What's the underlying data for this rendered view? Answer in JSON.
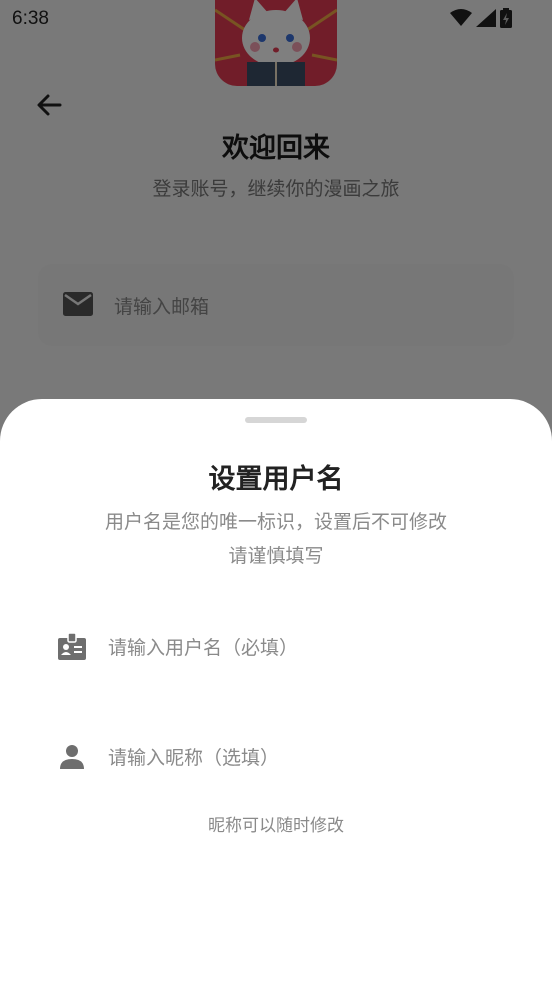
{
  "status_bar": {
    "time": "6:38",
    "icons": [
      "wifi-icon",
      "cell-signal-icon",
      "battery-icon"
    ]
  },
  "background_screen": {
    "mascot": "cat-reading-book-illustration",
    "back_icon": "arrow-left-icon",
    "title": "欢迎回来",
    "subtitle": "登录账号，继续你的漫画之旅",
    "email": {
      "icon": "mail-icon",
      "placeholder": "请输入邮箱"
    }
  },
  "sheet": {
    "title": "设置用户名",
    "description_line1": "用户名是您的唯一标识，设置后不可修改",
    "description_line2": "请谨慎填写",
    "username_field": {
      "icon": "id-badge-icon",
      "placeholder": "请输入用户名（必填）"
    },
    "nickname_field": {
      "icon": "person-icon",
      "placeholder": "请输入昵称（选填）"
    },
    "hint": "昵称可以随时修改"
  },
  "colors": {
    "scrim": "#000000",
    "sheet_background": "#ffffff",
    "mascot_background": "#e23b52",
    "title_text": "#222222",
    "secondary_text": "#8a8a8a",
    "icon_gray": "#6e6e6e"
  }
}
